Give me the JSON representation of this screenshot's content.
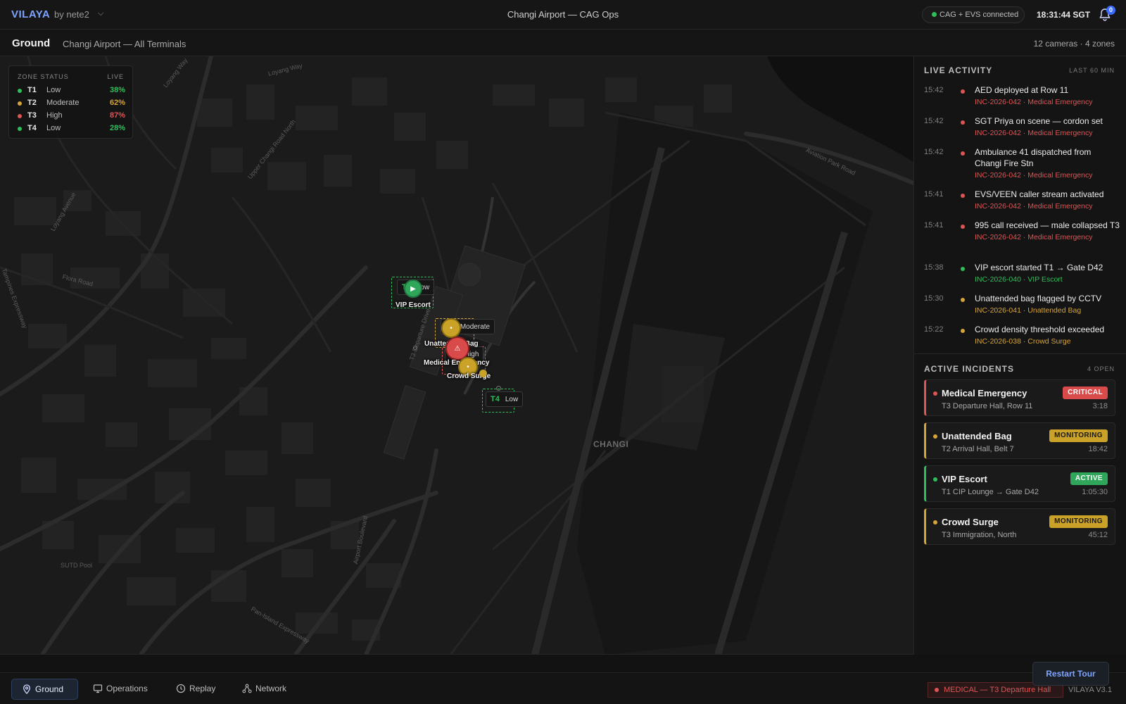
{
  "header": {
    "brand": "VILAYA",
    "brand_by": "by nete2",
    "title": "Changi Airport — CAG Ops",
    "connection": "CAG + EVS connected",
    "clock": "18:31:44 SGT",
    "notifications": "0"
  },
  "subheader": {
    "title": "Ground",
    "location": "Changi Airport — All Terminals",
    "counts": "12 cameras · 4 zones"
  },
  "zone_status": {
    "title": "ZONE STATUS",
    "live": "LIVE",
    "zones": [
      {
        "name": "T1",
        "level": "Low",
        "pct": "38%",
        "color": "#2fbf5a"
      },
      {
        "name": "T2",
        "level": "Moderate",
        "pct": "62%",
        "color": "#d6a53a"
      },
      {
        "name": "T3",
        "level": "High",
        "pct": "87%",
        "color": "#e05454"
      },
      {
        "name": "T4",
        "level": "Low",
        "pct": "28%",
        "color": "#2fbf5a"
      }
    ]
  },
  "map": {
    "area_label": "CHANGI",
    "tags": {
      "t1": "Low",
      "t1_name": "T1",
      "t2": "Moderate",
      "t2_name": "T2",
      "t3": "High",
      "t3_name": "T3",
      "t4": "Low",
      "t4_name": "T4"
    },
    "markers": {
      "vip": "VIP Escort",
      "bag": "Unattended Bag",
      "medical": "Medical Emergency",
      "crowd": "Crowd Surge"
    },
    "streets": [
      "Loyang Way",
      "Upper Changi Road North",
      "Loyang Avenue",
      "Flora Road",
      "Tampines Expressway",
      "Aviation Park Road",
      "Airport Boulevard",
      "Pan-Island Expressway",
      "SUTD Pool",
      "T3 Departure Drive"
    ]
  },
  "live_activity": {
    "title": "LIVE ACTIVITY",
    "range": "LAST 60 MIN",
    "items": [
      {
        "time": "15:42",
        "msg": "AED deployed at Row 11",
        "sub": "INC-2026-042 · Medical Emergency",
        "color": "#e05454"
      },
      {
        "time": "15:42",
        "msg": "SGT Priya on scene — cordon set",
        "sub": "INC-2026-042 · Medical Emergency",
        "color": "#e05454"
      },
      {
        "time": "15:42",
        "msg": "Ambulance 41 dispatched from Changi Fire Stn",
        "sub": "INC-2026-042 · Medical Emergency",
        "color": "#e05454"
      },
      {
        "time": "15:41",
        "msg": "EVS/VEEN caller stream activated",
        "sub": "INC-2026-042 · Medical Emergency",
        "color": "#e05454"
      },
      {
        "time": "15:41",
        "msg": "995 call received — male collapsed T3",
        "sub": "INC-2026-042 · Medical Emergency",
        "color": "#e05454"
      },
      {
        "time": "15:38",
        "msg": "VIP escort started T1 → Gate D42",
        "sub": "INC-2026-040 · VIP Escort",
        "color": "#2fbf5a"
      },
      {
        "time": "15:30",
        "msg": "Unattended bag flagged by CCTV",
        "sub": "INC-2026-041 · Unattended Bag",
        "color": "#d6a53a"
      },
      {
        "time": "15:22",
        "msg": "Crowd density threshold exceeded",
        "sub": "INC-2026-038 · Crowd Surge",
        "color": "#d6a53a"
      }
    ]
  },
  "active_incidents": {
    "title": "ACTIVE INCIDENTS",
    "count": "4 OPEN",
    "items": [
      {
        "name": "Medical Emergency",
        "where": "T3 Departure Hall, Row 11",
        "badge": "CRITICAL",
        "elapsed": "3:18",
        "color": "#e05454",
        "badge_bg": "#d94a4a",
        "badge_fg": "#ffffff"
      },
      {
        "name": "Unattended Bag",
        "where": "T2 Arrival Hall, Belt 7",
        "badge": "MONITORING",
        "elapsed": "18:42",
        "color": "#d6a53a",
        "badge_bg": "#c9a227",
        "badge_fg": "#1a1a1a"
      },
      {
        "name": "VIP Escort",
        "where": "T1 CIP Lounge → Gate D42",
        "badge": "ACTIVE",
        "elapsed": "1:05:30",
        "color": "#2fbf5a",
        "badge_bg": "#2fa65a",
        "badge_fg": "#ffffff"
      },
      {
        "name": "Crowd Surge",
        "where": "T3 Immigration, North",
        "badge": "MONITORING",
        "elapsed": "45:12",
        "color": "#d6a53a",
        "badge_bg": "#c9a227",
        "badge_fg": "#1a1a1a"
      }
    ]
  },
  "bottom_nav": {
    "items": [
      {
        "label": "Ground",
        "icon": "pin-icon",
        "active": true
      },
      {
        "label": "Operations",
        "icon": "monitor-icon",
        "active": false
      },
      {
        "label": "Replay",
        "icon": "clock-icon",
        "active": false
      },
      {
        "label": "Network",
        "icon": "network-icon",
        "active": false
      }
    ],
    "alert": "MEDICAL — T3 Departure Hall",
    "version": "VILAYA V3.1",
    "restart": "Restart Tour"
  }
}
